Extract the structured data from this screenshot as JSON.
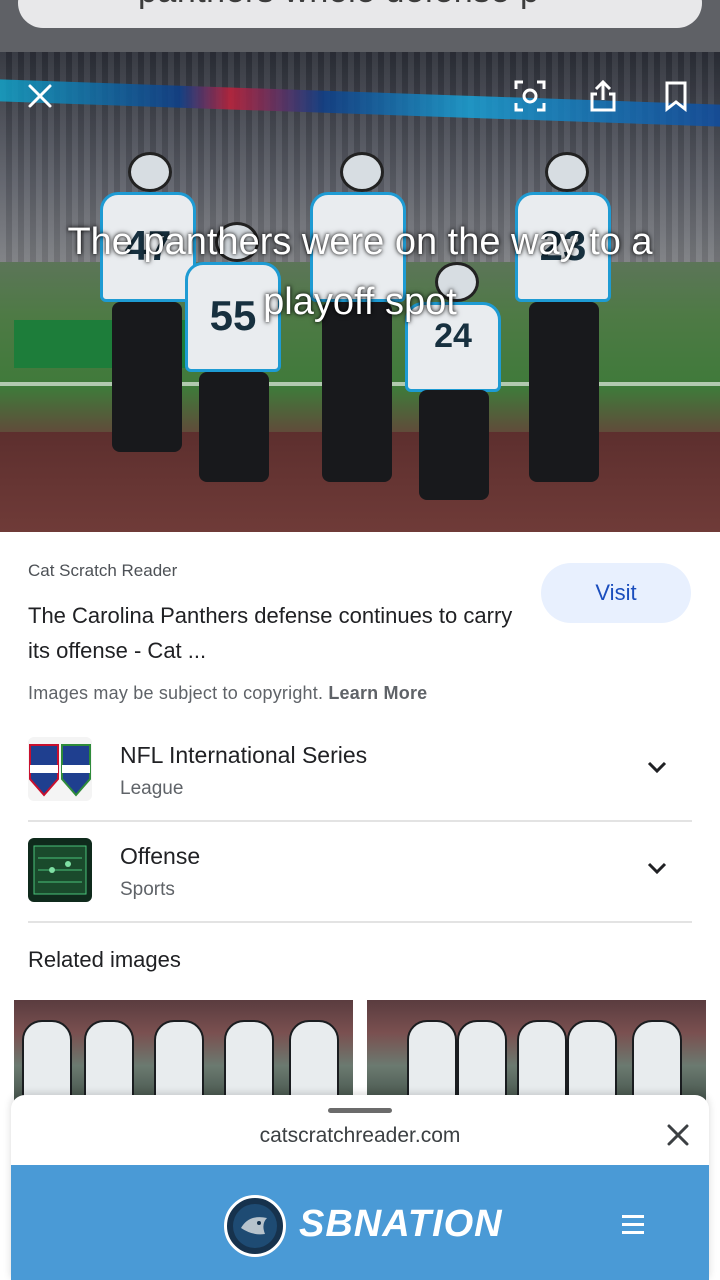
{
  "search": {
    "query": "panthers whole defense p"
  },
  "hero": {
    "caption": "The panthers were on the way to a playoff spot",
    "jersey_numbers": [
      "47",
      "55",
      "",
      "24",
      "23"
    ]
  },
  "result": {
    "source": "Cat Scratch Reader",
    "title": "The Carolina Panthers defense continues to carry its offense - Cat ...",
    "visit_label": "Visit",
    "copyright_text": "Images may be subject to copyright.",
    "learn_more": "Learn More"
  },
  "entities": [
    {
      "name": "NFL International Series",
      "type": "League"
    },
    {
      "name": "Offense",
      "type": "Sports"
    }
  ],
  "related": {
    "heading": "Related images"
  },
  "sheet": {
    "url": "catscratchreader.com",
    "brand": "SBNATION"
  },
  "colors": {
    "visit_bg": "#e8f0fe",
    "visit_text": "#1a4dbd",
    "sbnation_bar": "#4a9ad6"
  }
}
